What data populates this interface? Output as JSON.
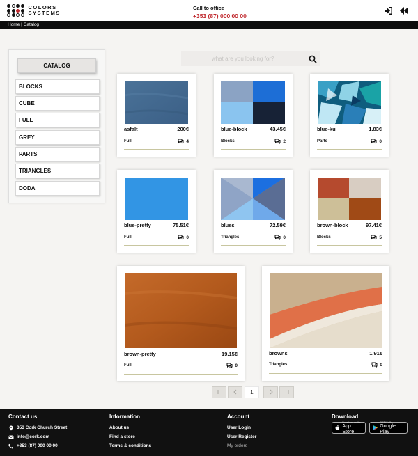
{
  "header": {
    "logo_line1": "COLORS",
    "logo_line2": "SYSTEMS",
    "call_label": "Call to office",
    "phone": "+353 (87) 000 00 00",
    "icons": [
      "login-icon",
      "back-icon"
    ]
  },
  "breadcrumb": {
    "text": "Home | Catalog"
  },
  "sidebar": {
    "title": "CATALOG",
    "items": [
      {
        "label": "BLOCKS"
      },
      {
        "label": "CUBE"
      },
      {
        "label": "FULL"
      },
      {
        "label": "GREY"
      },
      {
        "label": "PARTS"
      },
      {
        "label": "TRIANGLES"
      },
      {
        "label": "DODA"
      }
    ]
  },
  "search": {
    "placeholder": "what are you looking for?",
    "icon": "search-icon"
  },
  "products": [
    {
      "name": "asfalt",
      "price": "200€",
      "category": "Full",
      "comments": "4"
    },
    {
      "name": "blue-block",
      "price": "43.45€",
      "category": "Blocks",
      "comments": "2"
    },
    {
      "name": "blue-ku",
      "price": "1.83€",
      "category": "Parts",
      "comments": "0"
    },
    {
      "name": "blue-pretty",
      "price": "75.51€",
      "category": "Full",
      "comments": "0"
    },
    {
      "name": "blues",
      "price": "72.59€",
      "category": "Triangles",
      "comments": "0"
    },
    {
      "name": "brown-block",
      "price": "97.41€",
      "category": "Blocks",
      "comments": "5"
    },
    {
      "name": "brown-pretty",
      "price": "19.15€",
      "category": "Full",
      "comments": "0"
    },
    {
      "name": "browns",
      "price": "1.91€",
      "category": "Triangles",
      "comments": "0"
    }
  ],
  "pagination": {
    "current": "1"
  },
  "footer": {
    "contact": {
      "title": "Contact us",
      "address": "353 Cork Church Street",
      "email": "info@cork.com",
      "phone": "+353 (87) 000 00 00"
    },
    "information": {
      "title": "Information",
      "links": [
        "About us",
        "Find a store",
        "Terms & conditions"
      ]
    },
    "account": {
      "title": "Account",
      "links": [
        "User Login",
        "User Register",
        "My orders"
      ]
    },
    "download": {
      "title": "Download",
      "app_store_small": "Download on the",
      "app_store": "App Store",
      "google_small": "GET IT ON",
      "google": "Google Play"
    }
  }
}
